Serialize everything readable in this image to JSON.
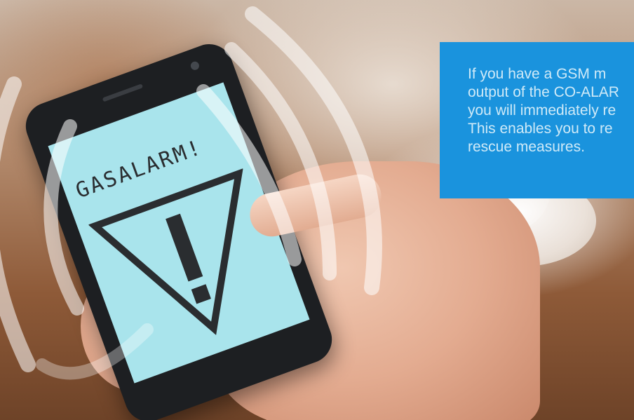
{
  "phone_screen": {
    "alarm_text": "GASALARM!",
    "warning_icon": "warning-triangle-icon"
  },
  "info_box": {
    "text": "If you have a GSM m\noutput of the CO-ALAR\nyou will immediately re\nThis enables you to re\nrescue measures."
  },
  "colors": {
    "info_box": "#1a93dd",
    "screen": "#a9e4ec",
    "phone": "#1d1f22"
  }
}
